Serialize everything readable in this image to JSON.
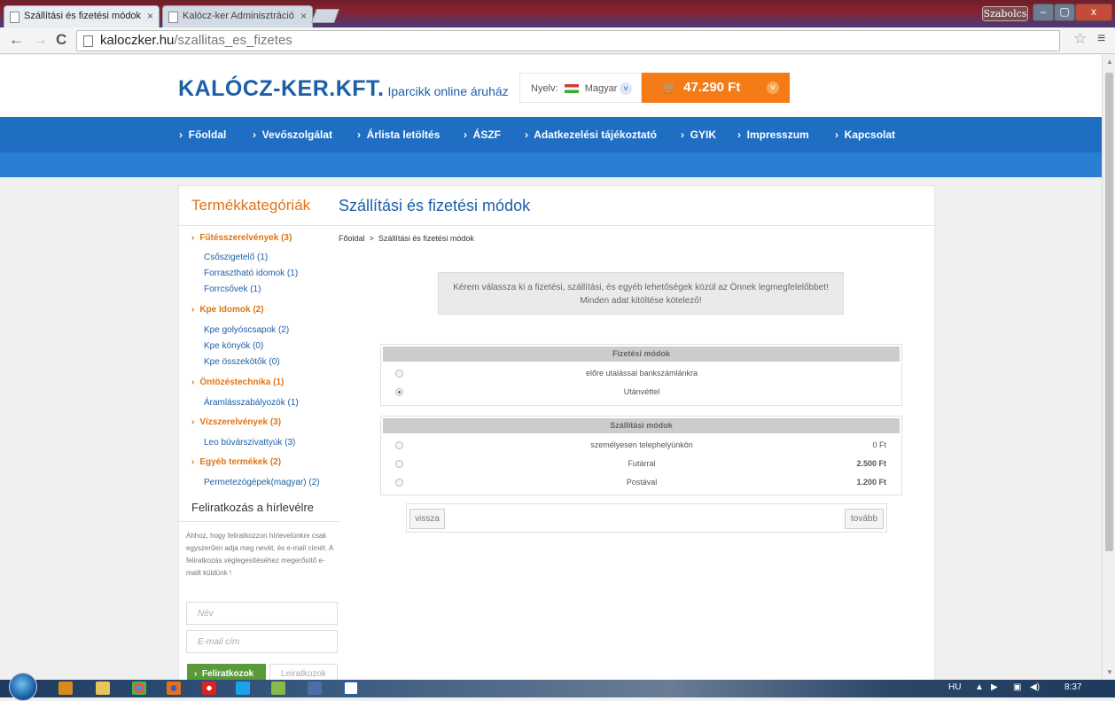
{
  "browser": {
    "tabs": [
      {
        "title": "Szállítási és fizetési módok"
      },
      {
        "title": "Kalócz-ker Adminisztráció"
      }
    ],
    "tab_close": "×",
    "user": "Szabolcs",
    "controls": {
      "min": "–",
      "max": "▢",
      "close": "x"
    },
    "url_host": "kaloczker.hu",
    "url_path": "/szallitas_es_fizetes",
    "back": "←",
    "forward": "→",
    "reload": "C",
    "star": "☆",
    "menu": "≡"
  },
  "header": {
    "logo": "KALÓCZ-KER.KFT.",
    "tagline": "Iparcikk online áruház",
    "language_label": "Nyelv:",
    "language_value": "Magyar",
    "cart_total": "47.290 Ft"
  },
  "nav": {
    "items": [
      {
        "label": "Főoldal"
      },
      {
        "label": "Vevőszolgálat"
      },
      {
        "label": "Árlista letöltés"
      },
      {
        "label": "ÁSZF"
      },
      {
        "label": "Adatkezelési tájékoztató"
      },
      {
        "label": "GYIK"
      },
      {
        "label": "Impresszum"
      },
      {
        "label": "Kapcsolat"
      }
    ]
  },
  "sidebar": {
    "title": "Termékkategóriák",
    "categories": [
      {
        "label": "Fűtésszerelvények (3)",
        "subs": [
          "Csőszigetelő (1)",
          "Forrasztható idomok (1)",
          "Forrcsővek (1)"
        ]
      },
      {
        "label": "Kpe Idomok (2)",
        "subs": [
          "Kpe golyóscsapok (2)",
          "Kpe könyök (0)",
          "Kpe összekötők (0)"
        ]
      },
      {
        "label": "Öntözéstechnika (1)",
        "subs": [
          "Áramlásszabályozók (1)"
        ]
      },
      {
        "label": "Vízszerelvények (3)",
        "subs": [
          "Leo búvárszivattyúk (3)"
        ]
      },
      {
        "label": "Egyéb termékek (2)",
        "subs": [
          "Permetezógépek(magyar) (2)"
        ]
      }
    ],
    "newsletter": {
      "title": "Feliratkozás a hírlevélre",
      "text": "Ahhoz, hogy feliratkozzon hírlevelünkre csak egyszerűen adja meg nevét, és e-mail címét. A feliratkozás véglegesítéséhez megerősítő e-mailt küldünk !",
      "name_placeholder": "Név",
      "email_placeholder": "E-mail cím",
      "subscribe": "Feliratkozok",
      "unsubscribe": "Leiratkozok"
    }
  },
  "main": {
    "title": "Szállítási és fizetési módok",
    "breadcrumb": [
      "Főoldal",
      ">",
      "Szállítási és fizetési módok"
    ],
    "notice": "Kérem válassza ki a fizetési, szállítási, és egyéb lehetőségek közül az Önnek legmegfelelőbbet! Minden adat kitöltése kötelező!",
    "payment": {
      "header": "Fizetési módok",
      "options": [
        {
          "label": "előre utalással bankszámlánkra",
          "selected": false
        },
        {
          "label": "Utánvéttel",
          "selected": true
        }
      ]
    },
    "shipping": {
      "header": "Szállítási módok",
      "options": [
        {
          "label": "személyesen telephelyünkön",
          "price": "0 Ft",
          "selected": false
        },
        {
          "label": "Futárral",
          "price": "2.500 Ft",
          "selected": false
        },
        {
          "label": "Postával",
          "price": "1.200 Ft",
          "selected": false
        }
      ]
    },
    "back_button": "vissza",
    "next_button": "tovább"
  },
  "taskbar": {
    "lang": "HU",
    "clock": "8:37"
  },
  "colors": {
    "accent_orange": "#f47b16",
    "nav_blue": "#1f6ec3",
    "link_blue": "#1b5fa8",
    "category_orange": "#e07414",
    "subscribe_green": "#5b9a3a"
  }
}
